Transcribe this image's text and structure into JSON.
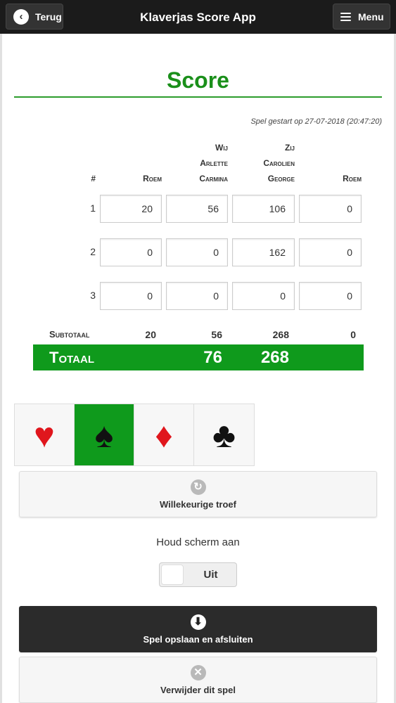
{
  "header": {
    "back_label": "Terug",
    "title": "Klaverjas Score App",
    "menu_label": "Menu"
  },
  "page_title": "Score",
  "started_text": "Spel gestart op 27-07-2018 (20:47:20)",
  "columns": {
    "hash": "#",
    "roem1": "Roem",
    "wij_label": "Wij",
    "wij_player1": "Arlette",
    "wij_player2": "Carmina",
    "zij_label": "Zij",
    "zij_player1": "Carolien",
    "zij_player2": "George",
    "roem2": "Roem"
  },
  "rows": [
    {
      "num": "1",
      "roem_wij": "20",
      "wij": "56",
      "zij": "106",
      "roem_zij": "0"
    },
    {
      "num": "2",
      "roem_wij": "0",
      "wij": "0",
      "zij": "162",
      "roem_zij": "0"
    },
    {
      "num": "3",
      "roem_wij": "0",
      "wij": "0",
      "zij": "0",
      "roem_zij": "0"
    }
  ],
  "subtotal": {
    "label": "Subtotaal",
    "roem_wij": "20",
    "wij": "56",
    "zij": "268",
    "roem_zij": "0"
  },
  "total": {
    "label": "Totaal",
    "wij": "76",
    "zij": "268"
  },
  "suits": {
    "hearts": "♥",
    "spades": "♠",
    "diamonds": "♦",
    "clubs": "♣",
    "active": "spades"
  },
  "random_trump_label": "Willekeurige troef",
  "keep_screen_label": "Houd scherm aan",
  "toggle_label": "Uit",
  "save_label": "Spel opslaan en afsluiten",
  "delete_label": "Verwijder dit spel",
  "colors": {
    "accent_green": "#0f9a1c",
    "header_bg": "#1b1b1b"
  }
}
